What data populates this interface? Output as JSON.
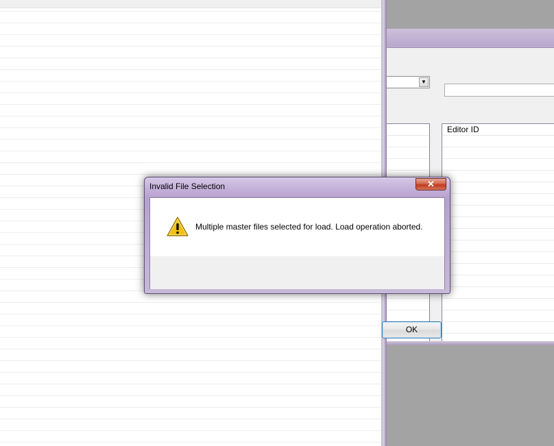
{
  "dialog": {
    "title": "Invalid File Selection",
    "close_label": "✕",
    "message": "Multiple master files selected for load. Load operation aborted.",
    "icon": "warning-icon",
    "ok_label": "OK"
  },
  "background_window": {
    "list_header": "Editor ID",
    "combo_arrow": "▼"
  },
  "colors": {
    "frame_accent": "#b9a7cc",
    "close_button": "#c03b1e",
    "warning_yellow": "#f2c012"
  }
}
